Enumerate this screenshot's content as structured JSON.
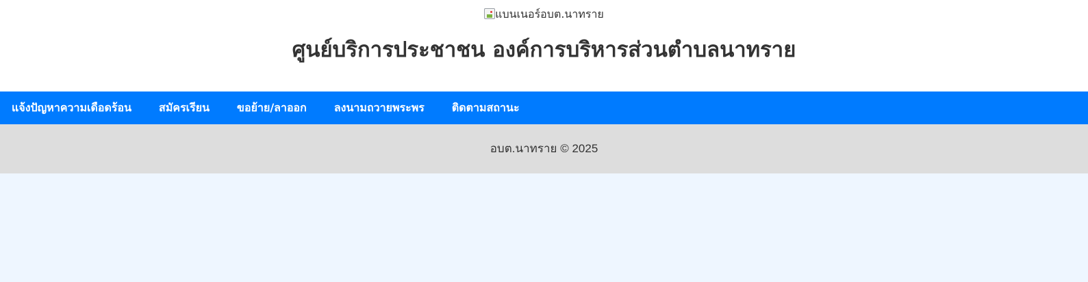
{
  "header": {
    "banner_alt": "แบนเนอร์อบต.นาทราย",
    "title": "ศูนย์บริการประชาชน องค์การบริหารส่วนตำบลนาทราย",
    "background_color": "#ffffff"
  },
  "nav": {
    "background_color": "#007bff",
    "items": [
      {
        "label": "แจ้งปัญหาความเดือดร้อน"
      },
      {
        "label": "สมัครเรียน"
      },
      {
        "label": "ขอย้าย/ลาออก"
      },
      {
        "label": "ลงนามถวายพระพร"
      },
      {
        "label": "ติดตามสถานะ"
      }
    ]
  },
  "footer": {
    "text": "อบต.นาทราย © 2025",
    "background_color": "#dddddd"
  },
  "page": {
    "background_color": "#eef6ff"
  }
}
